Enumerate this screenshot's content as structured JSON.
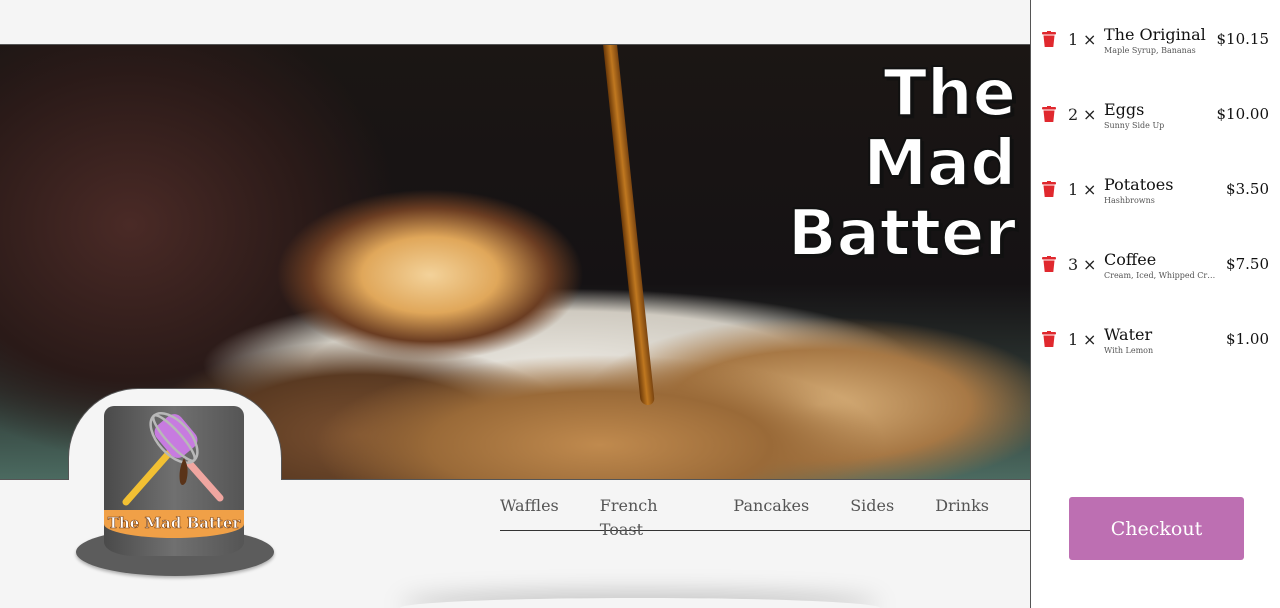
{
  "hero": {
    "title_lines": [
      "The",
      "Mad",
      "Batter"
    ]
  },
  "logo": {
    "band_text": "The Mad Batter"
  },
  "nav": {
    "items": [
      "Waffles",
      "French Toast",
      "Pancakes",
      "Sides",
      "Drinks"
    ]
  },
  "cart": {
    "multiply_symbol": "×",
    "items": [
      {
        "qty": "1",
        "name": "The Original",
        "detail": "Maple Syrup, Bananas",
        "price": "$10.15"
      },
      {
        "qty": "2",
        "name": "Eggs",
        "detail": "Sunny Side Up",
        "price": "$10.00"
      },
      {
        "qty": "1",
        "name": "Potatoes",
        "detail": "Hashbrowns",
        "price": "$3.50"
      },
      {
        "qty": "3",
        "name": "Coffee",
        "detail": "Cream, Iced, Whipped Cream",
        "price": "$7.50"
      },
      {
        "qty": "1",
        "name": "Water",
        "detail": "With Lemon",
        "price": "$1.00"
      }
    ],
    "checkout_label": "Checkout"
  },
  "colors": {
    "accent": "#bd6fb2",
    "trash": "#e0282e",
    "logo_band": "#f0a047"
  },
  "icons": {
    "remove": "trash-icon",
    "logo": "top-hat-whisk-spatula-logo"
  }
}
